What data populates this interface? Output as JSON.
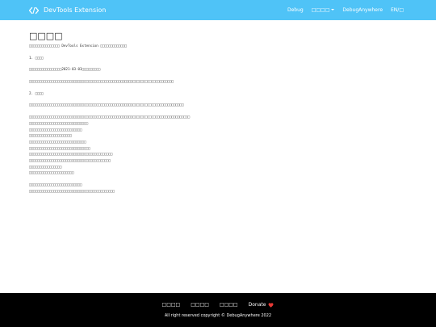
{
  "navbar": {
    "brand": "DevTools Extension",
    "links": [
      "Debug",
      "□□□□",
      "DebugAnywhere",
      "EN/□"
    ]
  },
  "content": {
    "title": "□□□□",
    "intro": "□□□□□□□□□□□□□□□ DevTools Extension □□□□□□□□□□□□□",
    "section1_heading": "1. □□□□",
    "section1_line1": "□□□□□□□□□□□□□□□□2021-03-03□□□□□□□□□",
    "section1_line2": "□□□□□□□□□□□□□□□□□□□□□□□□□□□□□□□□□□□□□□□□□□□□□□□□□□□□□□□□□□□□□□□□□□□□□□□",
    "section2_heading": "2. □□□□",
    "section2_para": "□□□□□□□□□□□□□□□□□□□□□□□□□□□□□□□□□□□□□□□□□□□□□□□□□□□□□□□□□□□□□□□□□□□□□□□□□□□□",
    "list_lead": "□□□□□□□□□□□□□□□□□□□□□□□□□□□□□□□□□□□□□□□□□□□□□□□□□□□□□□□□□□□□□□□□□□□□□□□□□□□□□□□",
    "list_items": [
      "□□□□□□□□□□□□□□□□□□□□□□□□□□□□□",
      "□□□□□□□□□□□□□□□□□□□□□□□□□□",
      "□□□□□□□□□□□□□□□□□□□□□",
      "□□□□□□□□□□□□□□□□□□□□□□□□□□□□",
      "□□□□□□□□□□□□□□□□□□□□□□□□□□□□□□",
      "□□□□□□□□□□□□□□□□□□□□□□□□□□□□□□□□□□□□□□□□□",
      "□□□□□□□□□□□□□□□□□□□□□□□□□□□□□□□□□□□□□□□□",
      "□□□□□□□□□□□□□□□□",
      "□□□□□□□□□□□□□□□□□□□□□□"
    ],
    "closing_1": "□□□□□□□□□□□□□□□□□□□□□□□□□□",
    "closing_2": "□□□□□□□□□□□□□□□□□□□□□□□□□□□□□□□□□□□□□□□□□□"
  },
  "footer": {
    "links": [
      "□□□□",
      "□□□□",
      "□□□□"
    ],
    "donate": "Donate",
    "copyright": "All right reserved copyright © DebugAnywhere 2022"
  },
  "colors": {
    "navbar": "#4fc3f7",
    "footer": "#000000",
    "heart": "#e53935"
  }
}
